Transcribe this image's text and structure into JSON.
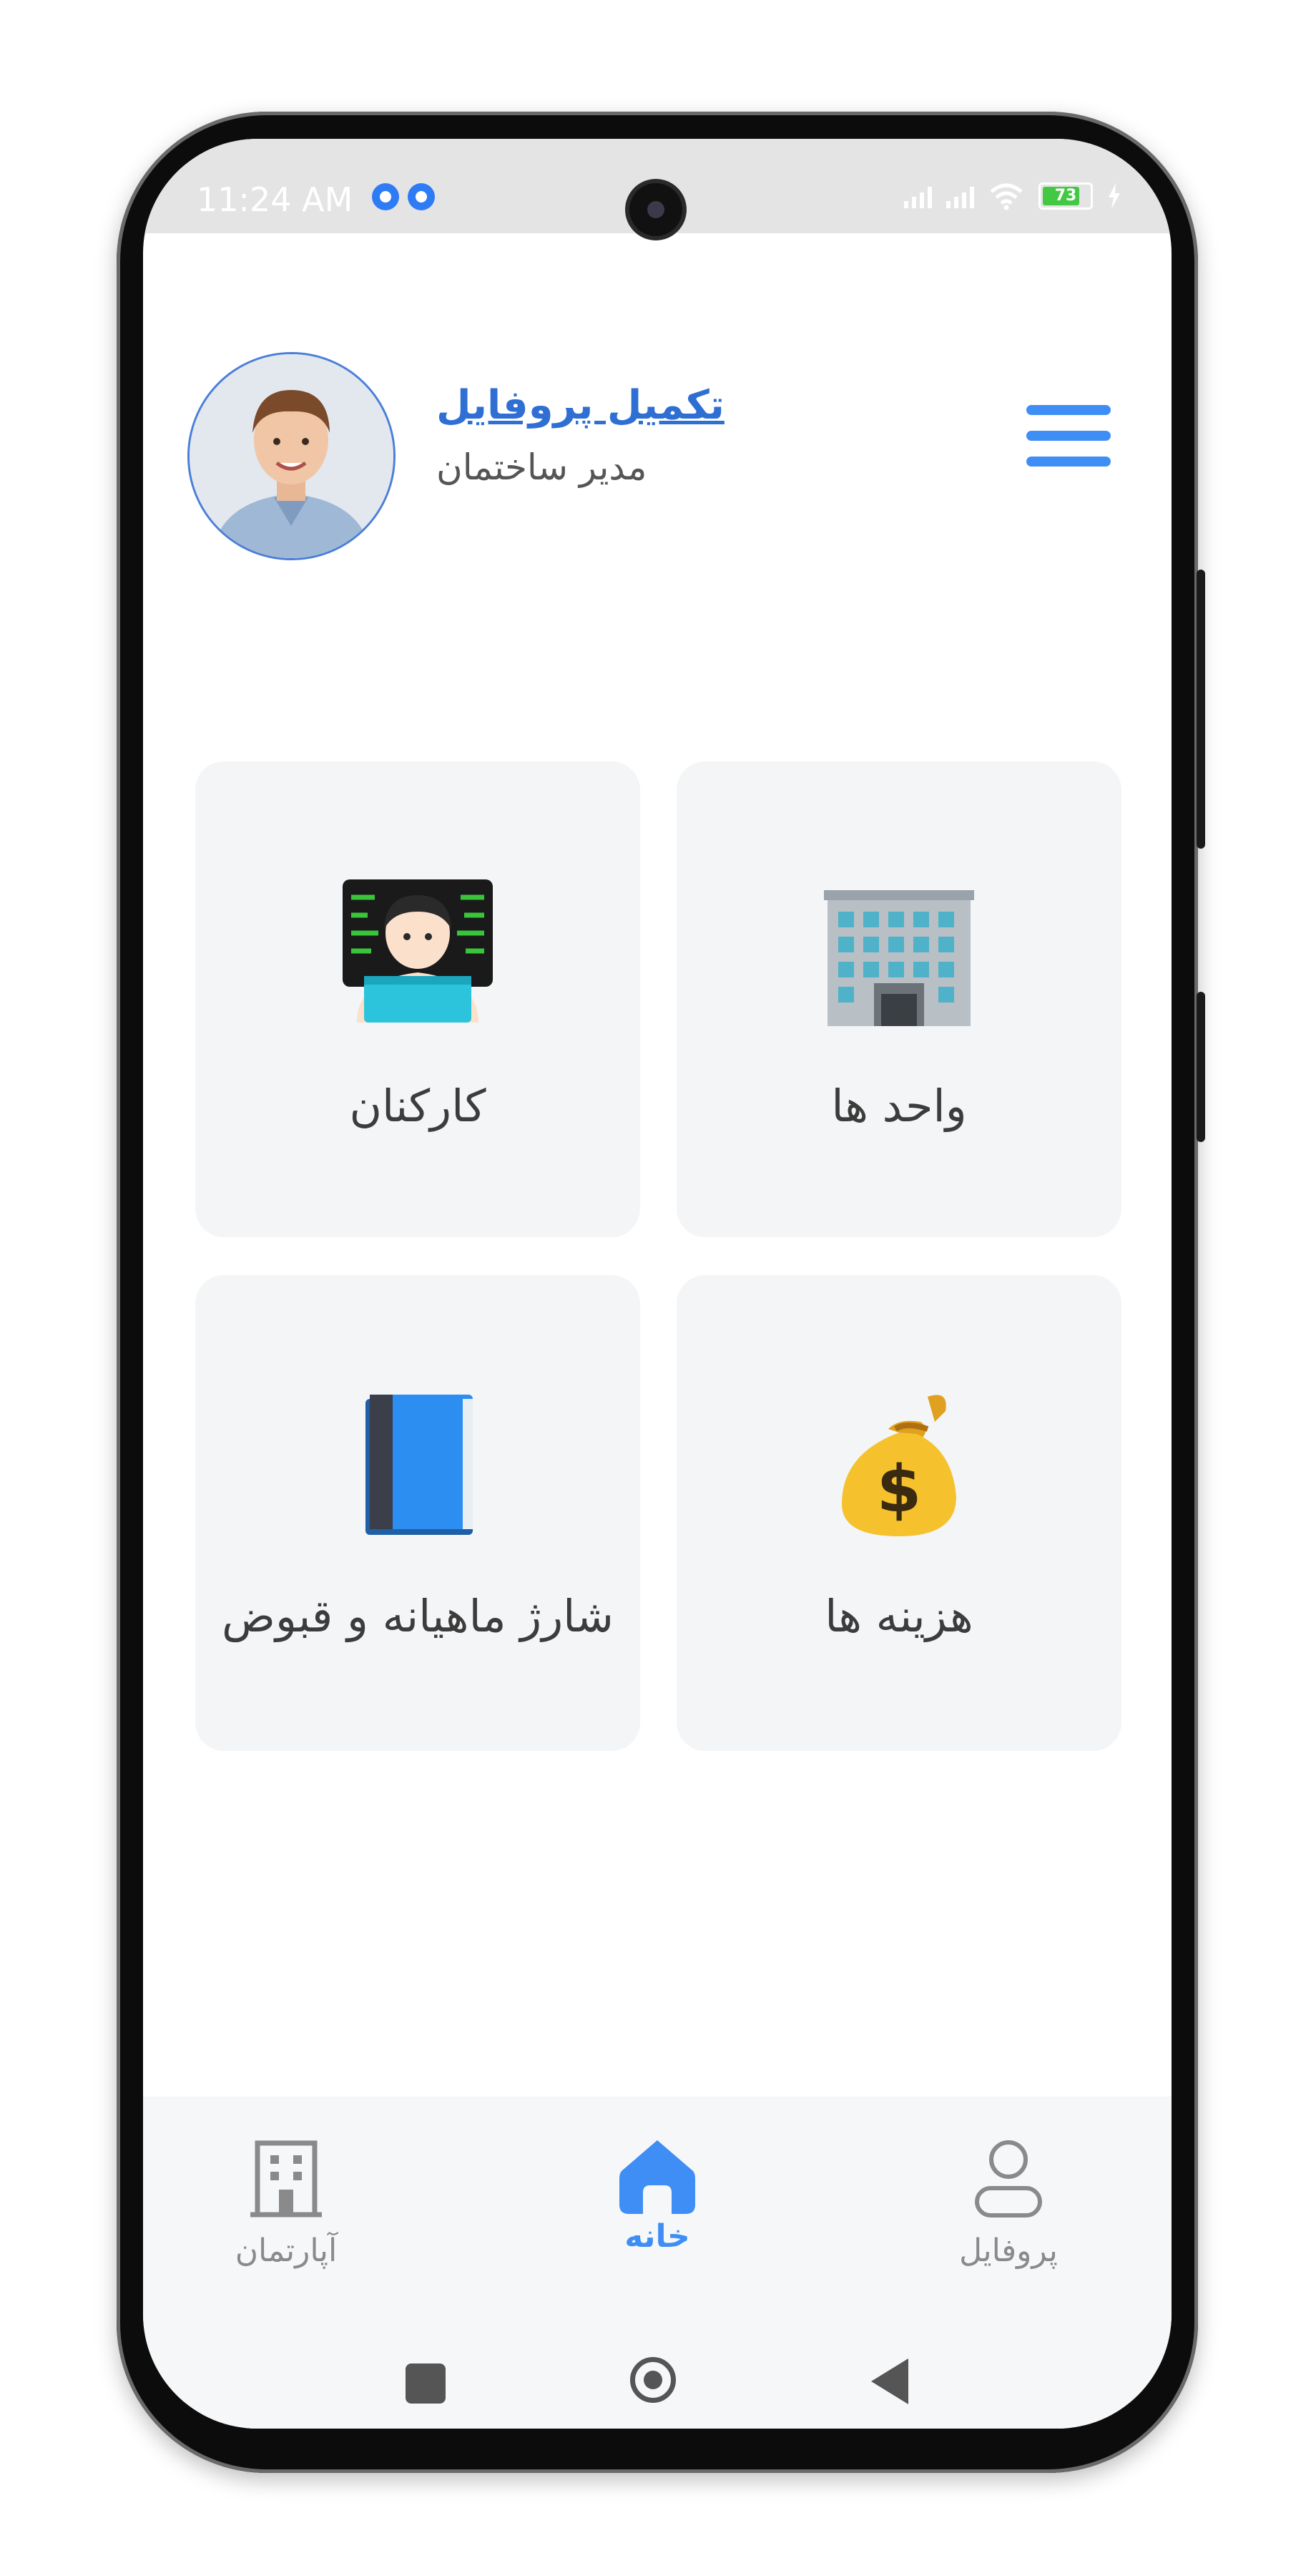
{
  "status_bar": {
    "time": "11:24 AM",
    "battery": "73"
  },
  "header": {
    "profile_link": "تکمیل پروفایل",
    "role": "مدیر ساختمان"
  },
  "cards": [
    {
      "label": "کارکنان",
      "icon": "developer-emoji-icon"
    },
    {
      "label": "واحد ها",
      "icon": "building-emoji-icon"
    },
    {
      "label": "شارژ ماهیانه و قبوض",
      "icon": "blue-book-icon"
    },
    {
      "label": "هزینه ها",
      "icon": "money-bag-icon"
    }
  ],
  "bottom_nav": {
    "items": [
      {
        "label": "آپارتمان",
        "icon": "apartment-building-icon"
      },
      {
        "label": "خانه",
        "icon": "home-icon",
        "active": true
      },
      {
        "label": "پروفایل",
        "icon": "user-icon"
      }
    ],
    "active_color": "#3f8ef5",
    "inactive_color": "#8a8a8a"
  },
  "colors": {
    "accent": "#3f8ef5",
    "card_bg": "#f3f5f7"
  }
}
